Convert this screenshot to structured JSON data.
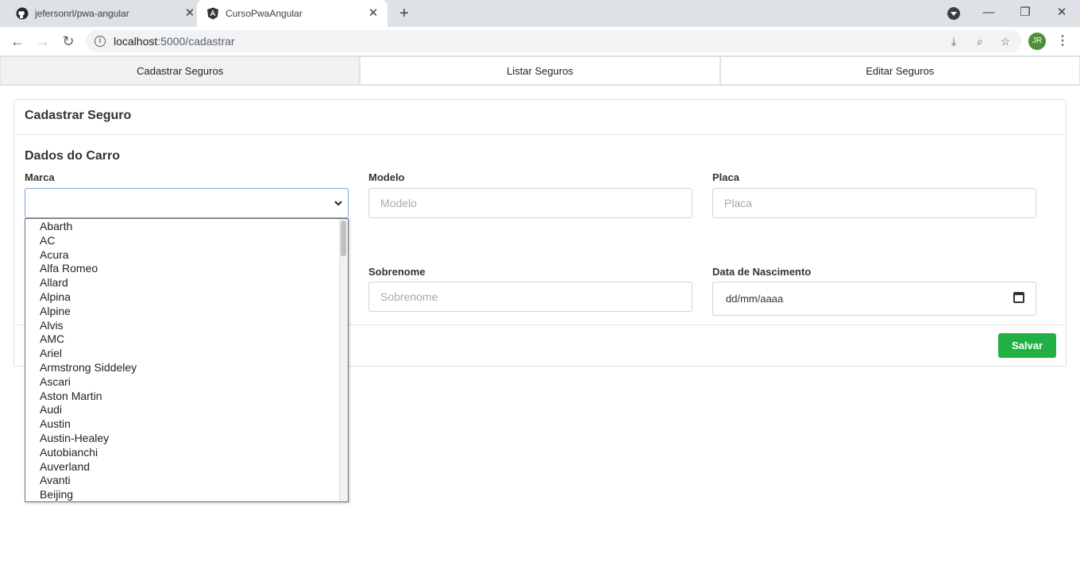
{
  "browser": {
    "tabs": [
      {
        "title": "jefersonrl/pwa-angular",
        "icon": "github-icon"
      },
      {
        "title": "CursoPwaAngular",
        "icon": "angular-icon"
      }
    ],
    "url_host": "localhost",
    "url_path": ":5000/cadastrar",
    "avatar": "JR"
  },
  "nav_tabs": [
    "Cadastrar Seguros",
    "Listar Seguros",
    "Editar Seguros"
  ],
  "card": {
    "title": "Cadastrar Seguro",
    "section_title": "Dados do Carro",
    "marca_label": "Marca",
    "modelo_label": "Modelo",
    "modelo_placeholder": "Modelo",
    "placa_label": "Placa",
    "placa_placeholder": "Placa",
    "sobrenome_label": "Sobrenome",
    "sobrenome_placeholder": "Sobrenome",
    "nascimento_label": "Data de Nascimento",
    "nascimento_value": "dd/mm/aaaa",
    "save_label": "Salvar"
  },
  "marca_options": [
    "Abarth",
    "AC",
    "Acura",
    "Alfa Romeo",
    "Allard",
    "Alpina",
    "Alpine",
    "Alvis",
    "AMC",
    "Ariel",
    "Armstrong Siddeley",
    "Ascari",
    "Aston Martin",
    "Audi",
    "Austin",
    "Austin-Healey",
    "Autobianchi",
    "Auverland",
    "Avanti",
    "Beijing"
  ]
}
